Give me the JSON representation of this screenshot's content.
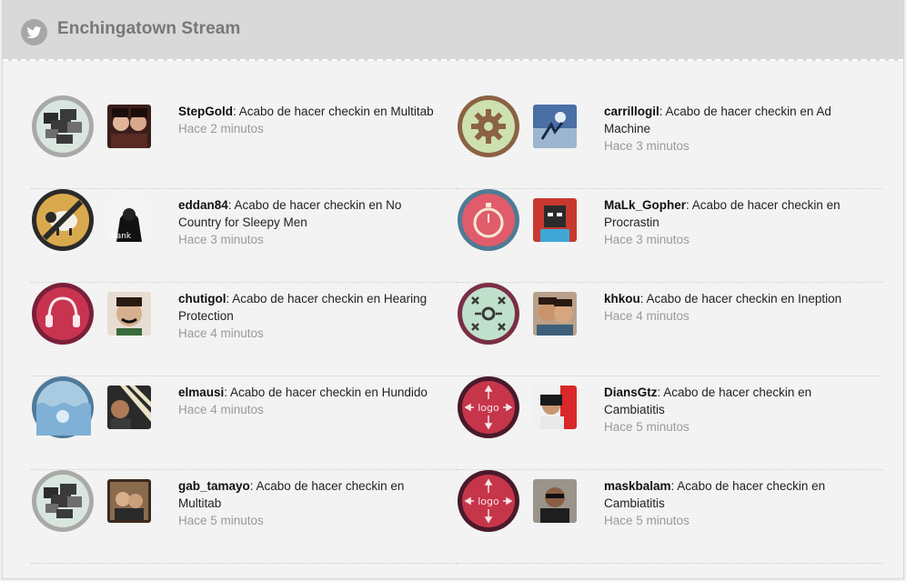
{
  "header": {
    "title": "Enchingatown Stream",
    "icon": "twitter-bird-icon"
  },
  "stream": [
    {
      "user": "StepGold",
      "message": ": Acabo de hacer checkin en Multitab",
      "time": "Hace 2 minutos",
      "badge": "multitab-badge-icon"
    },
    {
      "user": "carrillogil",
      "message": ": Acabo de hacer checkin en Ad Machine",
      "time": "Hace 3 minutos",
      "badge": "ad-machine-badge-icon"
    },
    {
      "user": "eddan84",
      "message": ": Acabo de hacer checkin en No Country for Sleepy Men",
      "time": "Hace 3 minutos",
      "badge": "no-sheep-badge-icon"
    },
    {
      "user": "MaLk_Gopher",
      "message": ": Acabo de hacer checkin en Procrastin",
      "time": "Hace 3 minutos",
      "badge": "stopwatch-badge-icon"
    },
    {
      "user": "chutigol",
      "message": ": Acabo de hacer checkin en Hearing Protection",
      "time": "Hace 4 minutos",
      "badge": "headphones-badge-icon"
    },
    {
      "user": "khkou",
      "message": ": Acabo de hacer checkin en Ineption",
      "time": "Hace 4 minutos",
      "badge": "inception-badge-icon"
    },
    {
      "user": "elmausi",
      "message": ": Acabo de hacer checkin en Hundido",
      "time": "Hace 4 minutos",
      "badge": "sunken-badge-icon"
    },
    {
      "user": "DiansGtz",
      "message": ": Acabo de hacer checkin en Cambiatitis",
      "time": "Hace 5 minutos",
      "badge": "logo-move-badge-icon",
      "badge_text": "logo"
    },
    {
      "user": "gab_tamayo",
      "message": ": Acabo de hacer checkin en Multitab",
      "time": "Hace 5 minutos",
      "badge": "multitab-badge-icon"
    },
    {
      "user": "maskbalam",
      "message": ": Acabo de hacer checkin en Cambiatitis",
      "time": "Hace 5 minutos",
      "badge": "logo-move-badge-icon",
      "badge_text": "logo"
    }
  ]
}
